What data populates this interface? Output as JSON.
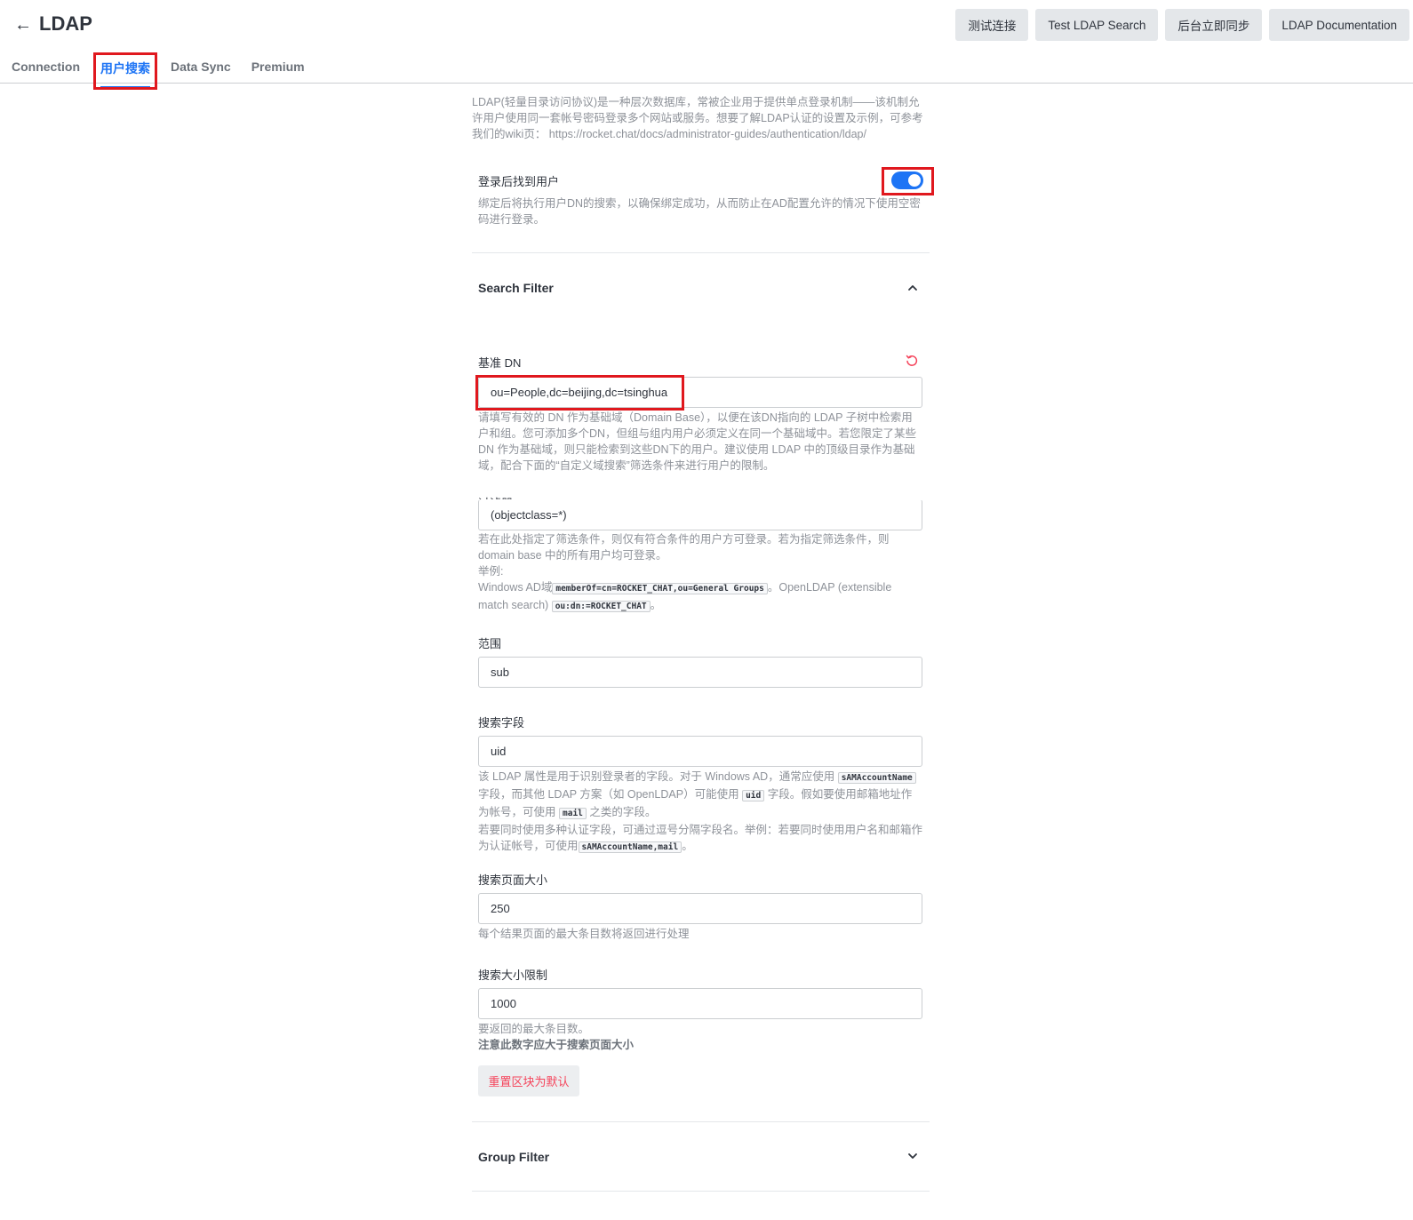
{
  "header": {
    "back_icon": "arrow-left-icon",
    "title": "LDAP",
    "actions": [
      "测试连接",
      "Test LDAP Search",
      "后台立即同步",
      "LDAP Documentation"
    ]
  },
  "tabs": [
    "Connection",
    "用户搜索",
    "Data Sync",
    "Premium"
  ],
  "active_tab": "用户搜索",
  "intro": "LDAP(轻量目录访问协议)是一种层次数据库，常被企业用于提供单点登录机制——该机制允许用户使用同一套帐号密码登录多个网站或服务。想要了解LDAP认证的设置及示例，可参考我们的wiki页： https://rocket.chat/docs/administrator-guides/authentication/ldap/",
  "find_user_after_login": {
    "label": "登录后找到用户",
    "enabled": true,
    "hint": "绑定后将执行用户DN的搜索，以确保绑定成功，从而防止在AD配置允许的情况下使用空密码进行登录。"
  },
  "search_filter_section": {
    "title": "Search Filter",
    "expanded": true,
    "base_dn": {
      "label": "基准 DN",
      "value": "ou=People,dc=beijing,dc=tsinghua",
      "hint": "请填写有效的 DN 作为基础域（Domain Base），以便在该DN指向的 LDAP 子树中检索用户和组。您可添加多个DN，但组与组内用户必须定义在同一个基础域中。若您限定了某些 DN 作为基础域，则只能检索到这些DN下的用户。建议使用 LDAP 中的顶级目录作为基础域，配合下面的“自定义域搜索”筛选条件来进行用户的限制。"
    },
    "filter": {
      "label": "过滤器",
      "value": "(objectclass=*)",
      "hint_line1": "若在此处指定了筛选条件，则仅有符合条件的用户方可登录。若为指定筛选条件，则 domain base 中的所有用户均可登录。",
      "hint_example": "举例:",
      "hint_ad_prefix": "Windows AD域",
      "hint_ad_code": "memberOf=cn=ROCKET_CHAT,ou=General Groups",
      "hint_openldap": "。OpenLDAP (extensible match search)",
      "hint_openldap_code": "ou:dn:=ROCKET_CHAT",
      "hint_end": "。"
    },
    "scope": {
      "label": "范围",
      "value": "sub"
    },
    "search_field": {
      "label": "搜索字段",
      "value": "uid",
      "hint_p1": "该 LDAP 属性是用于识别登录者的字段。对于 Windows AD，通常应使用",
      "code1": "sAMAccountName",
      "hint_p2": "字段，而其他 LDAP 方案（如 OpenLDAP）可能使用",
      "code2": "uid",
      "hint_p3": "字段。假如要使用邮箱地址作为帐号，可使用",
      "code3": "mail",
      "hint_p4": "之类的字段。",
      "hint_p5": "若要同时使用多种认证字段，可通过逗号分隔字段名。举例：若要同时使用用户名和邮箱作为认证帐号，可使用",
      "code4": "sAMAccountName,mail",
      "hint_p6": "。"
    },
    "page_size": {
      "label": "搜索页面大小",
      "value": "250",
      "hint": "每个结果页面的最大条目数将返回进行处理"
    },
    "size_limit": {
      "label": "搜索大小限制",
      "value": "1000",
      "hint1": "要返回的最大条目数。",
      "hint2_prefix": "注意此数字应大于",
      "hint2_bold": "搜索页面大小"
    },
    "reset_button": "重置区块为默认"
  },
  "group_filter_section": {
    "title": "Group Filter",
    "expanded": false
  },
  "colors": {
    "accent": "#1d74f5",
    "danger": "#f5455c",
    "annotation": "#e0181e"
  }
}
